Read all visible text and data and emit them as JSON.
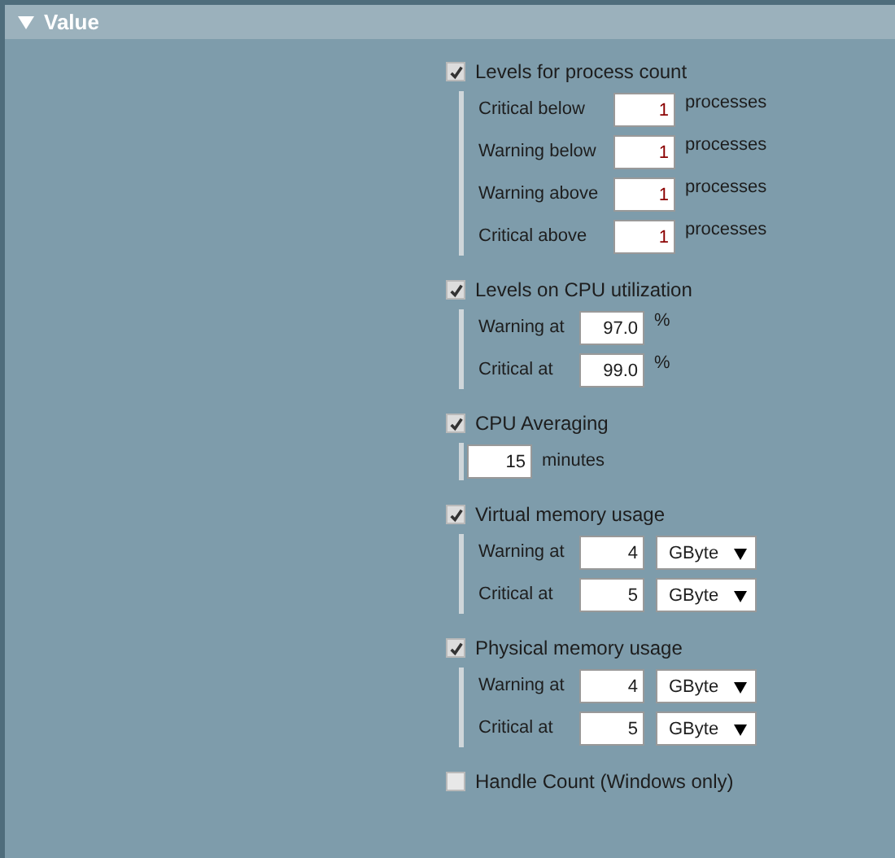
{
  "panel": {
    "title": "Value",
    "expanded": true
  },
  "sections": [
    {
      "title": "Levels for process count",
      "checked": true,
      "kind": "fields",
      "rows": [
        {
          "label": "Critical below",
          "value": "1",
          "unit": "processes",
          "changed": true
        },
        {
          "label": "Warning below",
          "value": "1",
          "unit": "processes",
          "changed": true
        },
        {
          "label": "Warning above",
          "value": "1",
          "unit": "processes",
          "changed": true
        },
        {
          "label": "Critical above",
          "value": "1",
          "unit": "processes",
          "changed": true
        }
      ]
    },
    {
      "title": "Levels on CPU utilization",
      "checked": true,
      "kind": "short",
      "rows": [
        {
          "label": "Warning at",
          "value": "97.0",
          "unit": "%",
          "changed": false
        },
        {
          "label": "Critical at",
          "value": "99.0",
          "unit": "%",
          "changed": false
        }
      ]
    },
    {
      "title": "CPU Averaging",
      "checked": true,
      "kind": "single",
      "rows": [
        {
          "value": "15",
          "unit": "minutes",
          "changed": false
        }
      ]
    },
    {
      "title": "Virtual memory usage",
      "checked": true,
      "kind": "select",
      "rows": [
        {
          "label": "Warning at",
          "value": "4",
          "unit": "GByte",
          "changed": false
        },
        {
          "label": "Critical at",
          "value": "5",
          "unit": "GByte",
          "changed": false
        }
      ]
    },
    {
      "title": "Physical memory usage",
      "checked": true,
      "kind": "select",
      "rows": [
        {
          "label": "Warning at",
          "value": "4",
          "unit": "GByte",
          "changed": false
        },
        {
          "label": "Critical at",
          "value": "5",
          "unit": "GByte",
          "changed": false
        }
      ]
    },
    {
      "title": "Handle Count (Windows only)",
      "checked": false
    }
  ]
}
